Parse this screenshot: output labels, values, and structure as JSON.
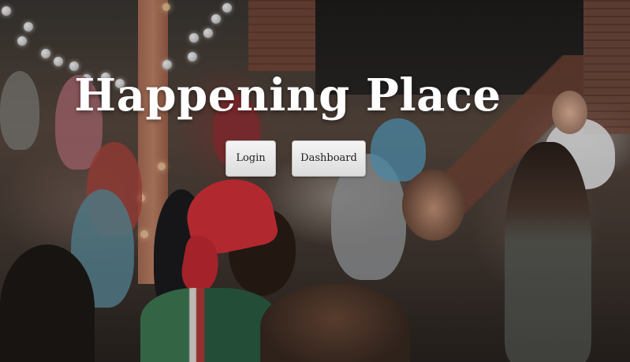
{
  "hero": {
    "title": "Happening Place"
  },
  "actions": {
    "login_label": "Login",
    "dashboard_label": "Dashboard"
  },
  "icons": {
    "background": "crowd-photo"
  }
}
